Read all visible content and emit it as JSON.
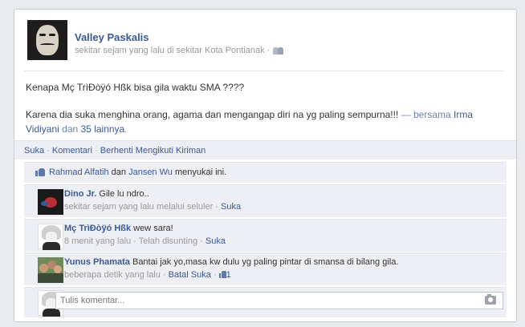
{
  "post": {
    "author": "Valley Paskalis",
    "meta": "sekitar sejam yang lalu di sekitar Kota Pontianak ·",
    "privacy_icon": "friends-icon",
    "line1": "Kenapa Mç TrìĐòÿó Hßk bisa gila waktu SMA ????",
    "line2": "Karena dia suka menghina orang, agama dan mengangap diri na yg paling sempurna!!!",
    "with_text": " — bersama ",
    "tagged": "Irma Vidiyani",
    "and_text": " dan ",
    "others": "35 lainnya",
    "end": "."
  },
  "actions": {
    "like": "Suka",
    "comment": "Komentari",
    "unfollow": "Berhenti Mengikuti Kiriman",
    "sep": " · "
  },
  "likes": {
    "person1": "Rahmad Alfatih",
    "and": " dan ",
    "person2": "Jansen Wu",
    "suffix": " menyukai ini."
  },
  "comments": [
    {
      "name": "Dino Jr.",
      "text": " Gile lu ndro..",
      "meta": "sekitar sejam yang lalu melalui seluler · ",
      "like": "Suka"
    },
    {
      "name": "Mç TrìĐòÿó Hßk",
      "text": " wew sara!",
      "meta": "8 menit yang lalu · Telah disunting · ",
      "like": "Suka"
    },
    {
      "name": "Yunus Phamata",
      "text": " Bantai jak yo,masa kw dulu yg paling pintar di smansa di bilang gila.",
      "meta": "beberapa detik yang lalu · ",
      "like": "Batal Suka",
      "sep": " · ",
      "like_count": "1"
    }
  ],
  "composer": {
    "placeholder": "Tulis komentar..."
  }
}
